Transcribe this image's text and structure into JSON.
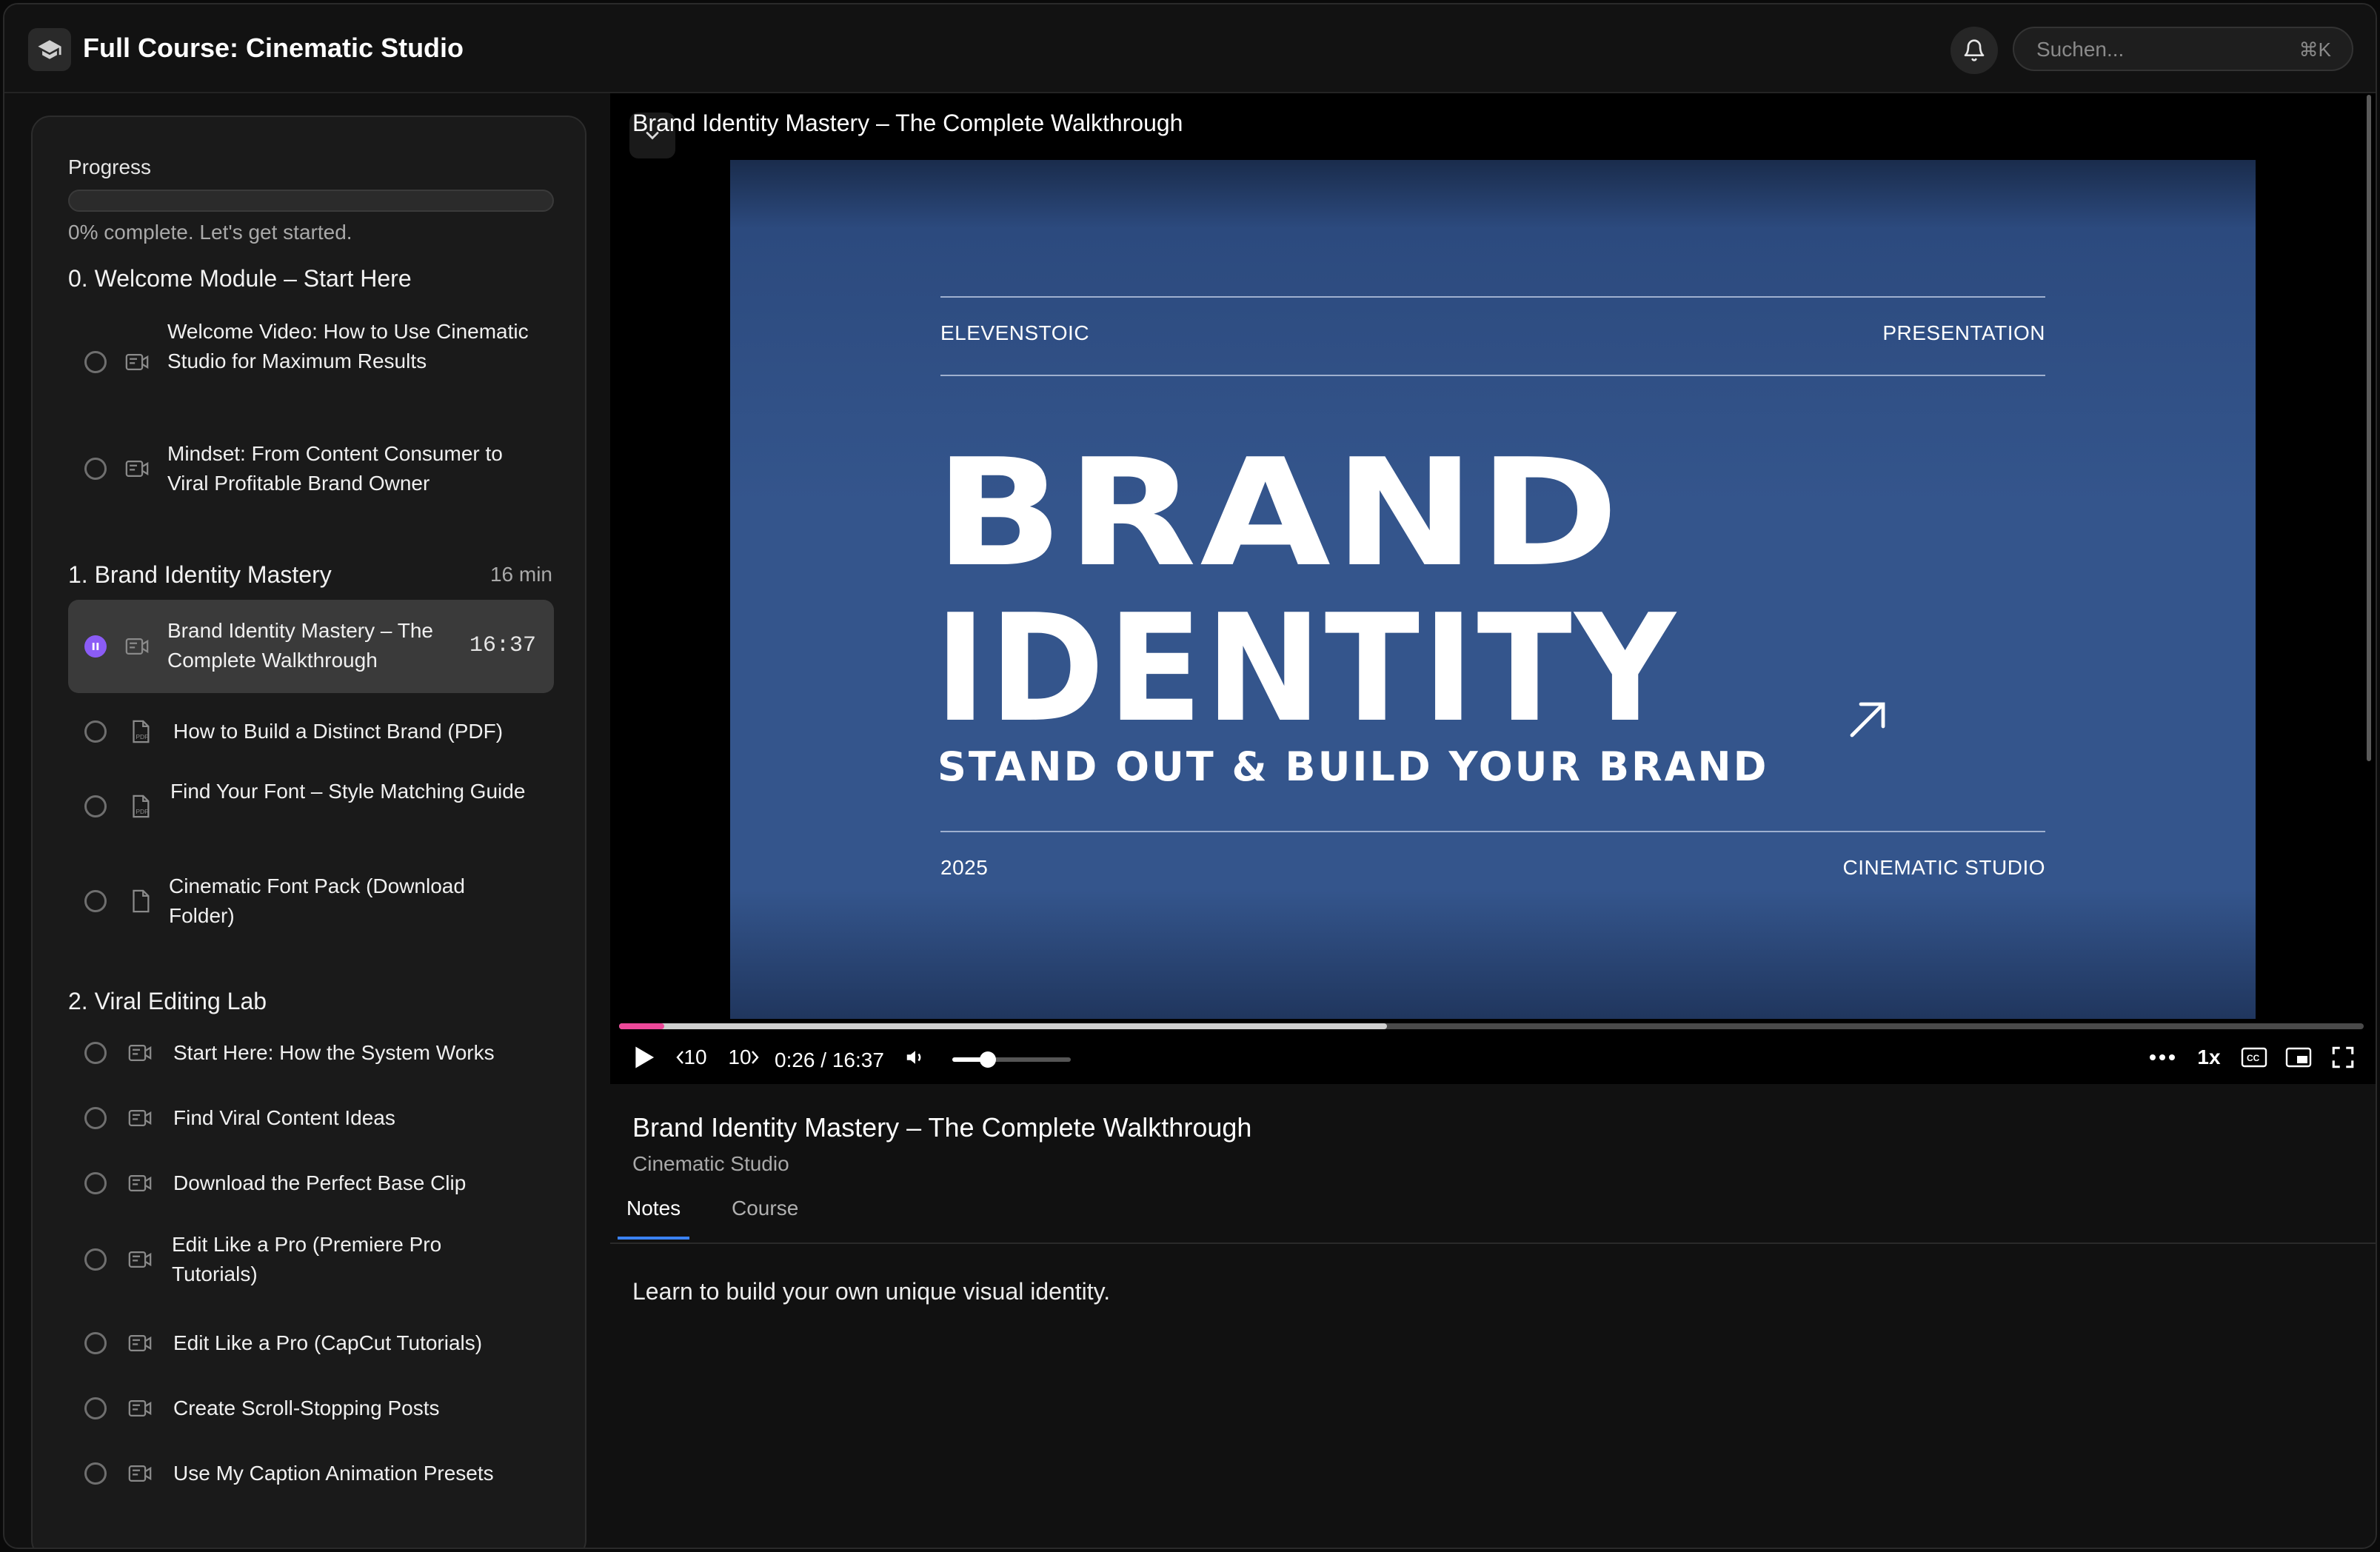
{
  "header": {
    "title": "Full Course: Cinematic Studio",
    "search_placeholder": "Suchen...",
    "search_shortcut": "⌘K"
  },
  "sidebar": {
    "progress_label": "Progress",
    "progress_value": 0,
    "progress_text": "0% complete. Let's get started.",
    "modules": [
      {
        "title": "0. Welcome Module – Start Here",
        "duration": "",
        "lessons": [
          {
            "title": "Welcome Video: How to Use Cinematic Studio for Maximum Results",
            "type": "video-icon"
          },
          {
            "title": "Mindset: From Content Consumer to Viral Profitable Brand Owner",
            "type": "video-icon"
          }
        ]
      },
      {
        "title": "1. Brand Identity Mastery",
        "duration": "16 min",
        "lessons": [
          {
            "title": "Brand Identity Mastery – The Complete Walkthrough",
            "type": "video-icon",
            "duration": "16:37",
            "active": true
          },
          {
            "title": "How to Build a Distinct Brand (PDF)",
            "type": "pdf-icon"
          },
          {
            "title": "Find Your Font – Style Matching Guide",
            "type": "pdf-icon"
          },
          {
            "title": "Cinematic Font Pack (Download Folder)",
            "type": "file-icon"
          }
        ]
      },
      {
        "title": "2. Viral Editing Lab",
        "duration": "",
        "lessons": [
          {
            "title": "Start Here: How the System Works",
            "type": "video-icon"
          },
          {
            "title": "Find Viral Content Ideas",
            "type": "video-icon"
          },
          {
            "title": "Download the Perfect Base Clip",
            "type": "video-icon"
          },
          {
            "title": "Edit Like a Pro (Premiere Pro Tutorials)",
            "type": "video-icon"
          },
          {
            "title": "Edit Like a Pro (CapCut Tutorials)",
            "type": "video-icon"
          },
          {
            "title": "Create Scroll-Stopping Posts",
            "type": "video-icon"
          },
          {
            "title": "Use My Caption Animation Presets",
            "type": "video-icon"
          }
        ]
      }
    ]
  },
  "player": {
    "title": "Brand Identity Mastery – The Complete Walkthrough",
    "slide": {
      "top_left": "ELEVENSTOIC",
      "top_right": "PRESENTATION",
      "line1": "BRAND",
      "line2": "IDENTITY",
      "subtitle": "STAND OUT & BUILD YOUR BRAND",
      "bottom_left": "2025",
      "bottom_right": "CINEMATIC STUDIO"
    },
    "time": "0:26 / 16:37",
    "played_fraction": 0.026,
    "buffered_fraction": 0.44,
    "volume": 0.3,
    "skip_back": "10",
    "skip_forward": "10",
    "speed": "1x"
  },
  "lesson_info": {
    "title": "Brand Identity Mastery – The Complete Walkthrough",
    "subtitle": "Cinematic Studio",
    "tabs": [
      "Notes",
      "Course"
    ],
    "notes": "Learn to build your own unique visual identity."
  },
  "colors": {
    "accent": "#8b5cf6",
    "scrub_played": "#ec4899",
    "tab_underline": "#3b82f6",
    "slide_bg": "#34558c"
  }
}
